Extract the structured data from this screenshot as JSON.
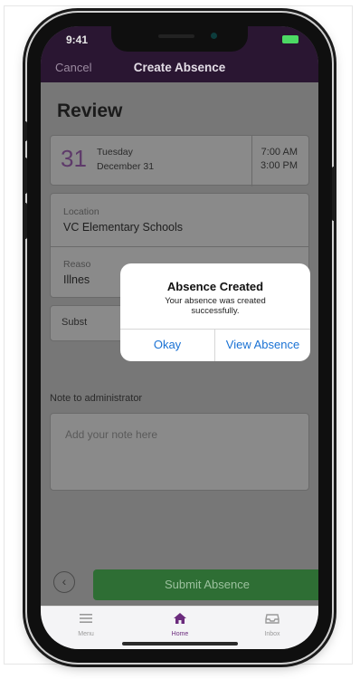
{
  "status_bar": {
    "time": "9:41"
  },
  "nav": {
    "cancel_label": "Cancel",
    "title": "Create Absence"
  },
  "review": {
    "title": "Review",
    "date": {
      "day": "31",
      "weekday": "Tuesday",
      "month_day": "December 31",
      "start_time": "7:00 AM",
      "end_time": "3:00 PM"
    },
    "location": {
      "label": "Location",
      "value": "VC Elementary Schools"
    },
    "reason": {
      "label": "Reaso",
      "value": "Illnes"
    },
    "substitute": {
      "label": "Subst"
    },
    "note": {
      "label": "Note to administrator",
      "placeholder": "Add your note here"
    }
  },
  "dialog": {
    "title": "Absence Created",
    "message": "Your absence was created successfully.",
    "ok_label": "Okay",
    "view_label": "View Absence"
  },
  "actions": {
    "submit_label": "Submit Absence"
  },
  "tabs": [
    {
      "label": "Menu",
      "icon": "menu-icon"
    },
    {
      "label": "Home",
      "icon": "home-icon"
    },
    {
      "label": "Inbox",
      "icon": "inbox-icon"
    }
  ],
  "colors": {
    "brand_purple": "#6b2b7d",
    "submit_green": "#2e6e34",
    "link_blue": "#1a72d4"
  }
}
